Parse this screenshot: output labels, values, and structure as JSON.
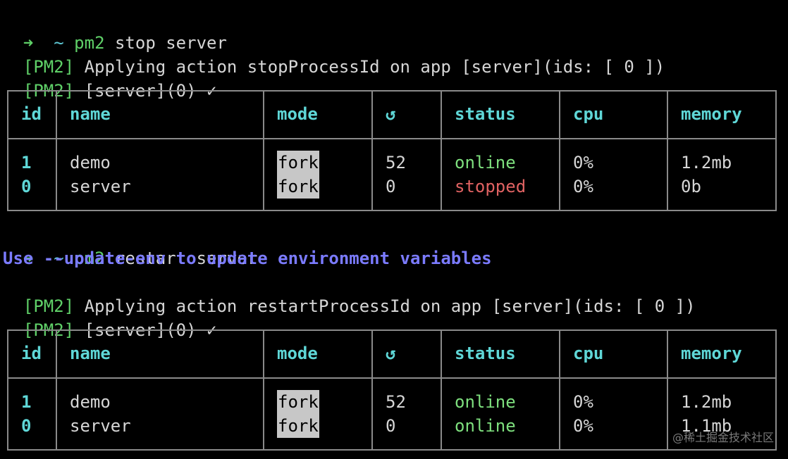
{
  "terminal": {
    "block1": {
      "prompt_arrow": "➜",
      "prompt_cwd": "~",
      "cmd_bin": "pm2",
      "cmd_args": " stop server",
      "log1_prefix": "[PM2]",
      "log1_text": " Applying action stopProcessId on app [server](ids: [ 0 ])",
      "log2_prefix": "[PM2]",
      "log2_text": " [server](0) ✓"
    },
    "block2": {
      "prompt_arrow": "➜",
      "prompt_cwd": "~",
      "cmd_bin": "pm2",
      "cmd_args": " restart server",
      "hint": "Use --update-env to update environment variables",
      "log1_prefix": "[PM2]",
      "log1_text": " Applying action restartProcessId on app [server](ids: [ 0 ])",
      "log2_prefix": "[PM2]",
      "log2_text": " [server](0) ✓"
    }
  },
  "tables": {
    "headers": {
      "id": "id",
      "name": "name",
      "mode": "mode",
      "restart": "↺",
      "status": "status",
      "cpu": "cpu",
      "memory": "memory"
    },
    "table1": {
      "rows": [
        {
          "id": "1",
          "name": "demo",
          "mode": "fork",
          "restart": "52",
          "status": "online",
          "cpu": "0%",
          "memory": "1.2mb"
        },
        {
          "id": "0",
          "name": "server",
          "mode": "fork",
          "restart": "0",
          "status": "stopped",
          "cpu": "0%",
          "memory": "0b"
        }
      ]
    },
    "table2": {
      "rows": [
        {
          "id": "1",
          "name": "demo",
          "mode": "fork",
          "restart": "52",
          "status": "online",
          "cpu": "0%",
          "memory": "1.2mb"
        },
        {
          "id": "0",
          "name": "server",
          "mode": "fork",
          "restart": "0",
          "status": "online",
          "cpu": "0%",
          "memory": "1.1mb"
        }
      ]
    }
  },
  "colors": {
    "background": "#000000",
    "prompt_green": "#5fd068",
    "header_cyan": "#5fd7d7",
    "online_green": "#7ee07e",
    "stopped_red": "#e06262",
    "hint_blue": "#7b7bff"
  },
  "watermark": "@稀土掘金技术社区"
}
